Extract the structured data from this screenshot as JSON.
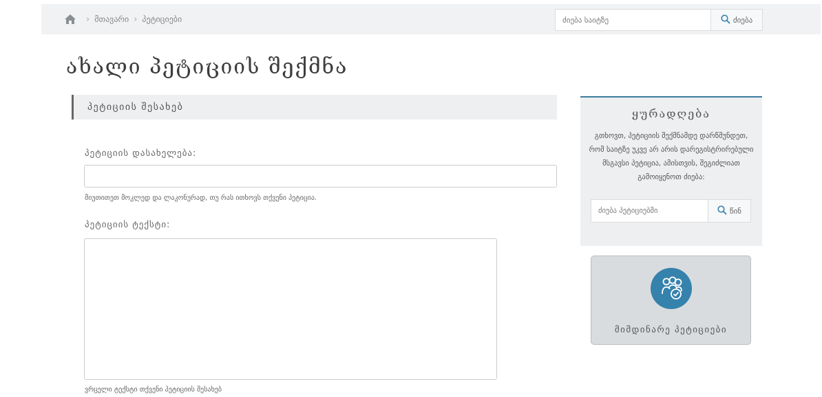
{
  "header": {
    "breadcrumb": [
      "მთავარი",
      "პეტიციები"
    ],
    "search": {
      "placeholder": "ძიება საიტზე",
      "button_label": "ძიება"
    }
  },
  "page_title": "ახალი პეტიციის შექმნა",
  "section_heading": "პეტიციის შესახებ",
  "form": {
    "name_label": "პეტიციის დასახელება:",
    "name_value": "",
    "name_hint": "მიუთითეთ მოკლედ და ლაკონურად, თუ რას ითხოვს თქვენი პეტიცია.",
    "text_label": "პეტიციის ტექსტი:",
    "text_value": "",
    "text_hint": "ვრცელი ტექსტი თქვენი პეტიციის შესახებ"
  },
  "notice": {
    "title": "ყურადღება",
    "body": "გთხოვთ, პეტიციის შექმნამდე დარწმუნდეთ, რომ საიტზე უკვე არ არის დარეგისტრირებული მსგავსი პეტიცია, ამისთვის, შეგიძლიათ გამოიყენოთ ძიება:",
    "search": {
      "placeholder": "ძიება პეტიციებში",
      "button_label": "წინ"
    }
  },
  "current_petitions": {
    "label": "მიმდინარე პეტიციები"
  },
  "colors": {
    "accent": "#3582ac",
    "panel": "#eeeff0",
    "topbar": "#f1f2f3"
  },
  "icons": [
    "home-icon",
    "chevron-right-icon",
    "search-icon",
    "people-check-icon"
  ]
}
